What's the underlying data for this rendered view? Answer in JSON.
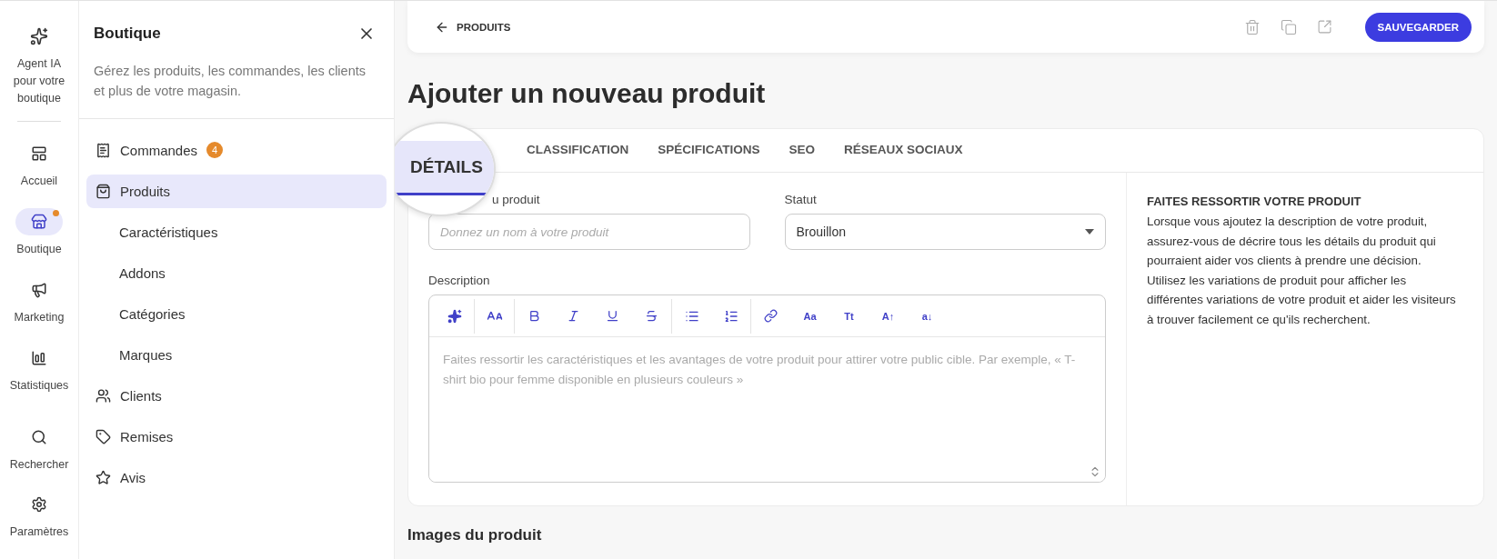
{
  "rail": {
    "items": [
      {
        "label": "Agent IA pour votre boutique",
        "selected": false,
        "dot": false
      },
      {
        "label": "Accueil",
        "selected": false,
        "dot": false
      },
      {
        "label": "Boutique",
        "selected": true,
        "dot": true
      },
      {
        "label": "Marketing",
        "selected": false,
        "dot": false
      },
      {
        "label": "Statistiques",
        "selected": false,
        "dot": false
      }
    ],
    "bottom_items": [
      {
        "label": "Rechercher"
      },
      {
        "label": "Paramètres"
      }
    ]
  },
  "panel": {
    "title": "Boutique",
    "description": "Gérez les produits, les commandes, les clients et plus de votre magasin.",
    "items": [
      {
        "label": "Commandes",
        "kind": "main",
        "selected": false,
        "badge": "4"
      },
      {
        "label": "Produits",
        "kind": "main",
        "selected": true
      },
      {
        "label": "Caractéristiques",
        "kind": "sub",
        "selected": false
      },
      {
        "label": "Addons",
        "kind": "sub",
        "selected": false
      },
      {
        "label": "Catégories",
        "kind": "sub",
        "selected": false
      },
      {
        "label": "Marques",
        "kind": "sub",
        "selected": false
      },
      {
        "label": "Clients",
        "kind": "main",
        "selected": false
      },
      {
        "label": "Remises",
        "kind": "main",
        "selected": false
      },
      {
        "label": "Avis",
        "kind": "main",
        "selected": false
      }
    ]
  },
  "topbar": {
    "back_label": "PRODUITS",
    "save_label": "SAUVEGARDER"
  },
  "page_title": "Ajouter un nouveau produit",
  "tabs": [
    {
      "label": "DÉTAILS",
      "selected": true
    },
    {
      "label": "CLASSIFICATION",
      "selected": false
    },
    {
      "label": "SPÉCIFICATIONS",
      "selected": false
    },
    {
      "label": "SEO",
      "selected": false
    },
    {
      "label": "RÉSEAUX SOCIAUX",
      "selected": false
    }
  ],
  "form": {
    "name_label": "u produit",
    "name_placeholder": "Donnez un nom à votre produit",
    "status_label": "Statut",
    "status_value": "Brouillon",
    "description_label": "Description",
    "toolbar_text_buttons": [
      "Aa",
      "Tt",
      "A↑",
      "a↓"
    ],
    "description_placeholder": "Faites ressortir les caractéristiques et les avantages de votre produit pour attirer votre public cible. Par exemple, « T-shirt bio pour femme disponible en plusieurs couleurs »"
  },
  "help": {
    "title": "FAITES RESSORTIR VOTRE PRODUIT",
    "text": "Lorsque vous ajoutez la description de votre produit, assurez-vous de décrire tous les détails du produit qui pourraient aider vos clients à prendre une décision. Utilisez les variations de produit pour afficher les différentes variations de votre produit et aider les visiteurs à trouver facilement ce qu'ils recherchent."
  },
  "images_section_title": "Images du produit"
}
